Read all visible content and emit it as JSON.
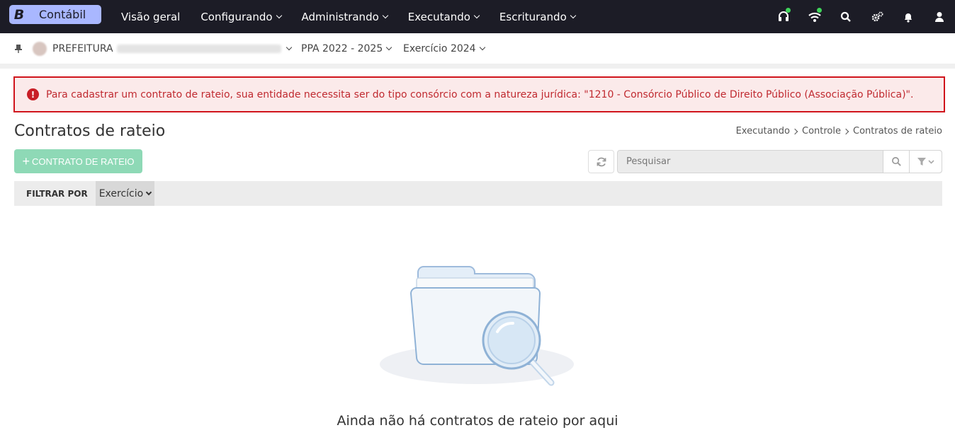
{
  "app": {
    "logo_letter": "B",
    "name": "Contábil"
  },
  "nav": [
    {
      "label": "Visão geral",
      "has_caret": false
    },
    {
      "label": "Configurando",
      "has_caret": true
    },
    {
      "label": "Administrando",
      "has_caret": true
    },
    {
      "label": "Executando",
      "has_caret": true
    },
    {
      "label": "Escriturando",
      "has_caret": true
    }
  ],
  "top_icons": [
    "support-icon",
    "wifi-icon",
    "search-icon",
    "settings-icon",
    "bell-icon",
    "user-icon"
  ],
  "context": {
    "entity_label": "PREFEITURA",
    "ppa": "PPA 2022 - 2025",
    "exercicio": "Exercício 2024"
  },
  "alert": {
    "text": "Para cadastrar um contrato de rateio, sua entidade necessita ser do tipo consórcio com a natureza jurídica: \"1210 - Consórcio Público de Direito Público (Associação Pública)\".",
    "color": "#c81e26"
  },
  "page": {
    "title": "Contratos de rateio",
    "breadcrumb": [
      "Executando",
      "Controle",
      "Contratos de rateio"
    ]
  },
  "toolbar": {
    "add_button": "CONTRATO DE RATEIO",
    "search_placeholder": "Pesquisar"
  },
  "filter": {
    "label": "FILTRAR POR",
    "selected": "Exercício"
  },
  "empty_state": {
    "message": "Ainda não há contratos de rateio por aqui"
  },
  "colors": {
    "topbar": "#1c1c26",
    "brand": "#a9b7ff",
    "add_button": "#8ed9b6",
    "status_dot": "#3fd45a"
  }
}
